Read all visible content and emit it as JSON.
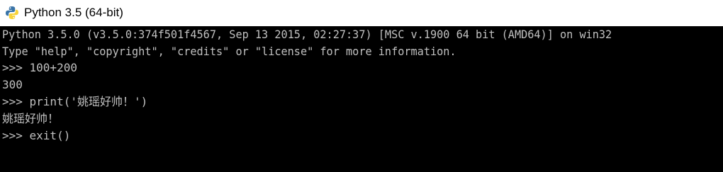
{
  "window": {
    "title": "Python 3.5 (64-bit)"
  },
  "console": {
    "lines": [
      "Python 3.5.0 (v3.5.0:374f501f4567, Sep 13 2015, 02:27:37) [MSC v.1900 64 bit (AMD64)] on win32",
      "Type \"help\", \"copyright\", \"credits\" or \"license\" for more information.",
      ">>> 100+200",
      "300",
      ">>> print('姚瑶好帅！')",
      "姚瑶好帅！",
      ">>> exit()"
    ]
  },
  "colors": {
    "console_background": "#000000",
    "console_text": "#c0c0c0",
    "titlebar_background": "#ffffff"
  },
  "icons": {
    "title_icon": "python-icon"
  }
}
